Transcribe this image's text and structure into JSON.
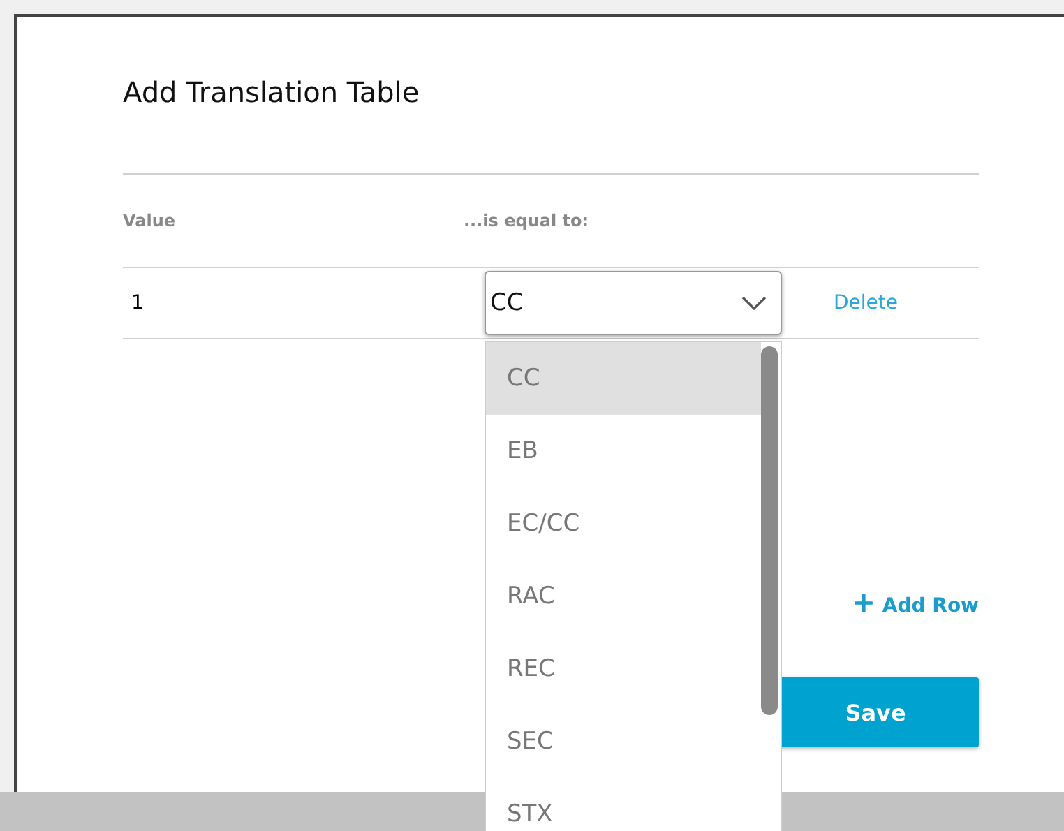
{
  "dialog": {
    "title": "Add Translation Table"
  },
  "table": {
    "columns": [
      "Value",
      "...is equal to:"
    ],
    "rows": [
      {
        "value": "1",
        "select": {
          "value": "CC",
          "open": true,
          "options": [
            {
              "label": "CC",
              "selected": true
            },
            {
              "label": "EB",
              "selected": false
            },
            {
              "label": "EC/CC",
              "selected": false
            },
            {
              "label": "RAC",
              "selected": false
            },
            {
              "label": "REC",
              "selected": false
            },
            {
              "label": "SEC",
              "selected": false
            },
            {
              "label": "STX",
              "selected": false
            }
          ]
        },
        "action": "Delete"
      }
    ]
  },
  "add_row": {
    "icon": "+",
    "label": "Add Row"
  },
  "save_button": "Save"
}
